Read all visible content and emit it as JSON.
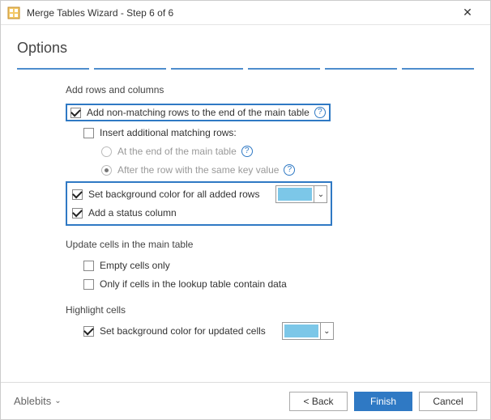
{
  "window": {
    "title": "Merge Tables Wizard - Step 6 of 6"
  },
  "heading": "Options",
  "sections": {
    "addRowsCols": {
      "label": "Add rows and columns",
      "nonMatching": {
        "label": "Add non-matching rows to the end of the main table",
        "checked": true
      },
      "insertAdditional": {
        "label": "Insert additional matching rows:",
        "checked": false
      },
      "radioEnd": {
        "label": "At the end of the main table"
      },
      "radioAfterKey": {
        "label": "After the row with the same key value",
        "selected": true
      },
      "bgAdded": {
        "label": "Set background color for all added rows",
        "checked": true,
        "color": "#7cc7e8"
      },
      "statusCol": {
        "label": "Add a status column",
        "checked": true
      }
    },
    "updateCells": {
      "label": "Update cells in the main table",
      "emptyOnly": {
        "label": "Empty cells only",
        "checked": false
      },
      "onlyIfLookup": {
        "label": "Only if cells in the lookup table contain data",
        "checked": false
      }
    },
    "highlight": {
      "label": "Highlight cells",
      "bgUpdated": {
        "label": "Set background color for updated cells",
        "checked": true,
        "color": "#7cc7e8"
      }
    }
  },
  "footer": {
    "brand": "Ablebits",
    "back": "<  Back",
    "finish": "Finish",
    "cancel": "Cancel"
  }
}
